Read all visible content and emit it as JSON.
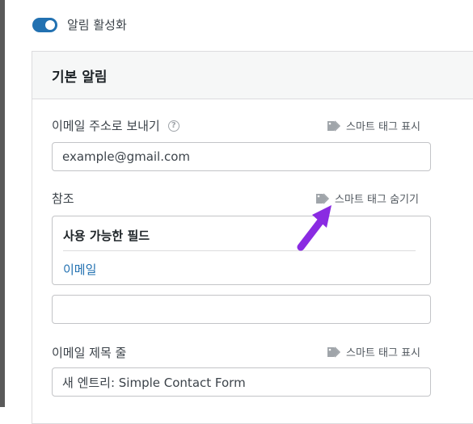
{
  "toggle": {
    "label": "알림 활성화",
    "enabled": true
  },
  "panel": {
    "title": "기본 알림",
    "email_to": {
      "label": "이메일 주소로 보내기",
      "smart_tag": "스마트 태그 표시",
      "value": "example@gmail.com"
    },
    "cc": {
      "label": "참조",
      "smart_tag": "스마트 태그 숨기기",
      "value": ""
    },
    "smart_tags_box": {
      "title": "사용 가능한 필드",
      "items": [
        "이메일"
      ]
    },
    "subject": {
      "label": "이메일 제목 줄",
      "smart_tag": "스마트 태그 표시",
      "value": "새 엔트리: Simple Contact Form"
    }
  },
  "colors": {
    "accent": "#2271b1",
    "arrow": "#8a2be2"
  },
  "icons": {
    "help": "help-icon",
    "tag": "tag-icon",
    "annotation": "arrow-pointer"
  }
}
